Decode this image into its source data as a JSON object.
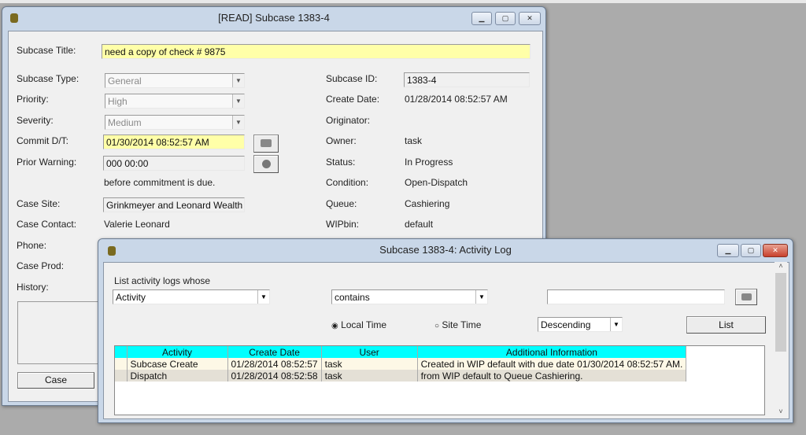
{
  "main_window": {
    "title": "[READ] Subcase 1383-4",
    "fields": {
      "subcase_title_label": "Subcase Title:",
      "subcase_title": "need a copy of check # 9875",
      "subcase_type_label": "Subcase Type:",
      "subcase_type": "General",
      "priority_label": "Priority:",
      "priority": "High",
      "severity_label": "Severity:",
      "severity": "Medium",
      "commit_label": "Commit D/T:",
      "commit": "01/30/2014 08:52:57 AM",
      "prior_warning_label": "Prior Warning:",
      "prior_warning": "000 00:00",
      "before_text": "before commitment is due.",
      "case_site_label": "Case Site:",
      "case_site": "Grinkmeyer and Leonard Wealth",
      "case_contact_label": "Case Contact:",
      "case_contact": "Valerie Leonard",
      "phone_label": "Phone:",
      "case_prod_label": "Case Prod:",
      "history_label": "History:",
      "subcase_id_label": "Subcase ID:",
      "subcase_id": "1383-4",
      "create_date_label": "Create Date:",
      "create_date": "01/28/2014 08:52:57 AM",
      "originator_label": "Originator:",
      "owner_label": "Owner:",
      "owner": "task",
      "status_label": "Status:",
      "status": "In Progress",
      "condition_label": "Condition:",
      "condition": "Open-Dispatch",
      "queue_label": "Queue:",
      "queue": "Cashiering",
      "wipbin_label": "WIPbin:",
      "wipbin": "default"
    },
    "case_button": "Case"
  },
  "activity_log": {
    "title": "Subcase 1383-4: Activity Log",
    "filter_label": "List activity logs whose",
    "field_select": "Activity",
    "operator_select": "contains",
    "filter_value": "",
    "local_time": "Local Time",
    "site_time": "Site Time",
    "sort": "Descending",
    "list_button": "List",
    "columns": [
      "Activity",
      "Create Date",
      "User",
      "Additional Information"
    ],
    "rows": [
      [
        "Subcase Create",
        "01/28/2014 08:52:57",
        "task",
        "Created in WIP default with due date 01/30/2014 08:52:57 AM."
      ],
      [
        "Dispatch",
        "01/28/2014 08:52:58",
        "task",
        "from WIP default to Queue Cashiering."
      ]
    ]
  }
}
